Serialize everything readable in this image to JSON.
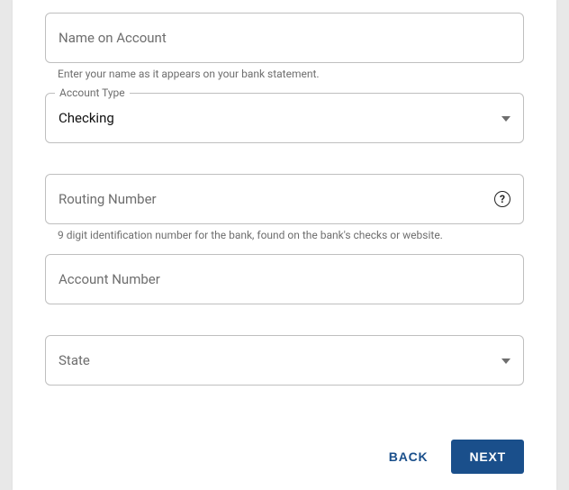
{
  "form": {
    "name_on_account": {
      "placeholder": "Name on Account",
      "helper": "Enter your name as it appears on your bank statement."
    },
    "account_type": {
      "legend": "Account Type",
      "value": "Checking"
    },
    "routing_number": {
      "placeholder": "Routing Number",
      "helper": "9 digit identification number for the bank, found on the bank's checks or website."
    },
    "account_number": {
      "placeholder": "Account Number"
    },
    "state": {
      "placeholder": "State"
    }
  },
  "actions": {
    "back": "BACK",
    "next": "NEXT"
  },
  "icons": {
    "help": "?"
  }
}
